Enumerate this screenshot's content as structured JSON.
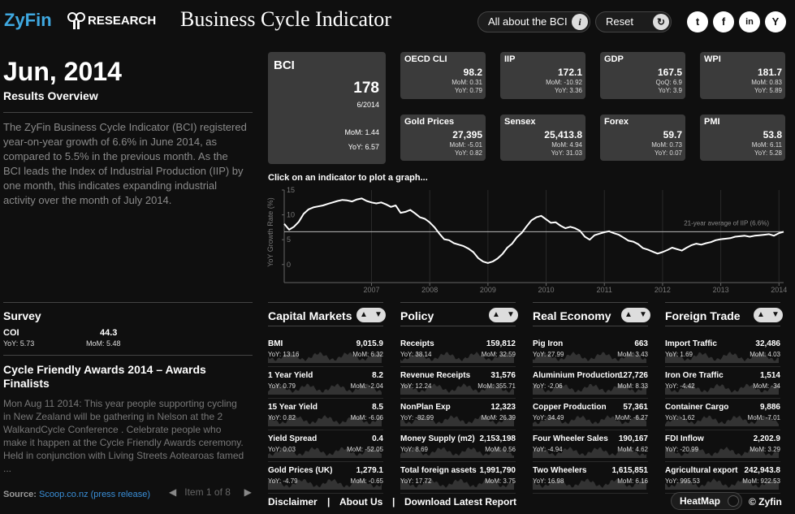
{
  "header": {
    "logo_zy": "ZyFin",
    "logo_research": "RESEARCH",
    "title": "Business Cycle Indicator",
    "about_label": "All about the BCI",
    "reset_label": "Reset",
    "social": [
      "t",
      "f",
      "in",
      "Y"
    ]
  },
  "overview": {
    "date": "Jun, 2014",
    "subtitle": "Results Overview",
    "summary": "The ZyFin Business Cycle Indicator (BCI) registered year-on-year growth of 6.6% in June 2014, as compared to 5.5% in the previous month. As the BCI leads the Index of Industrial Production (IIP) by one month, this indicates expanding industrial activity over the month of July 2014."
  },
  "survey": {
    "title": "Survey",
    "name": "COI",
    "value": "44.3",
    "yoy": "YoY: 5.73",
    "mom": "MoM: 5.48"
  },
  "news": {
    "title": "Cycle Friendly Awards 2014 – Awards Finalists",
    "body": "Mon Aug 11 2014: This year people supporting cycling in New Zealand will be gathering in Nelson at the 2 WalkandCycle Conference . Celebrate people who make it happen at the Cycle Friendly Awards ceremony. Held in conjunction with Living Streets Aotearoas famed ...",
    "source_label": "Source:",
    "source_link": "Scoop.co.nz (press release)",
    "pager": "Item 1 of 8"
  },
  "bci": {
    "name": "BCI",
    "value": "178",
    "period": "6/2014",
    "mom": "MoM: 1.44",
    "yoy": "YoY: 6.57"
  },
  "tiles": [
    {
      "name": "OECD CLI",
      "value": "98.2",
      "s1": "MoM: 0.31",
      "s2": "YoY: 0.79"
    },
    {
      "name": "IIP",
      "value": "172.1",
      "s1": "MoM: -10.92",
      "s2": "YoY: 3.36"
    },
    {
      "name": "GDP",
      "value": "167.5",
      "s1": "QoQ: 6.9",
      "s2": "YoY: 3.9"
    },
    {
      "name": "WPI",
      "value": "181.7",
      "s1": "MoM: 0.83",
      "s2": "YoY: 5.89"
    },
    {
      "name": "Gold Prices",
      "value": "27,395",
      "s1": "MoM: -5.01",
      "s2": "YoY: 0.82"
    },
    {
      "name": "Sensex",
      "value": "25,413.8",
      "s1": "MoM: 4.94",
      "s2": "YoY: 31.03"
    },
    {
      "name": "Forex",
      "value": "59.7",
      "s1": "MoM: 0.73",
      "s2": "YoY: 0.07"
    },
    {
      "name": "PMI",
      "value": "53.8",
      "s1": "MoM: 6.11",
      "s2": "YoY: 5.28"
    }
  ],
  "chart_hint": "Click on an indicator to plot a graph...",
  "chart_data": {
    "type": "line",
    "ylabel": "YoY Growth Rate (%)",
    "yticks": [
      "15",
      "10",
      "5",
      "0"
    ],
    "xticks": [
      "2007",
      "2008",
      "2009",
      "2010",
      "2011",
      "2012",
      "2013",
      "2014"
    ],
    "ylim": [
      -2,
      15
    ],
    "annotation": "21-year average of IIP (6.6%)",
    "average": 6.6,
    "series": [
      {
        "x_start": 2006.0,
        "x_step": 0.0833,
        "values": [
          8.2,
          7.0,
          7.6,
          8.6,
          10.2,
          11.1,
          11.5,
          11.7,
          11.9,
          12.2,
          12.5,
          12.8,
          13.0,
          12.9,
          12.7,
          13.1,
          13.3,
          12.8,
          12.5,
          12.3,
          12.5,
          12.1,
          11.6,
          11.9,
          10.4,
          10.6,
          11.0,
          10.3,
          9.5,
          9.2,
          8.5,
          7.5,
          6.2,
          5.1,
          4.9,
          4.3,
          4.0,
          3.7,
          3.2,
          2.5,
          1.3,
          0.6,
          0.3,
          0.6,
          1.2,
          2.1,
          3.4,
          4.2,
          5.5,
          6.4,
          7.7,
          8.9,
          9.5,
          9.8,
          9.1,
          8.4,
          8.5,
          7.8,
          7.3,
          7.6,
          7.3,
          6.8,
          5.6,
          5.0,
          5.9,
          6.2,
          6.5,
          6.7,
          6.3,
          6.0,
          5.4,
          4.8,
          4.6,
          4.1,
          3.3,
          3.0,
          2.6,
          2.2,
          2.5,
          2.9,
          3.4,
          3.1,
          2.8,
          3.4,
          3.9,
          4.2,
          4.0,
          4.3,
          4.5,
          4.9,
          5.1,
          5.2,
          5.3,
          5.6,
          5.7,
          5.8,
          5.6,
          5.8,
          5.9,
          6.0,
          6.1,
          5.8,
          6.3,
          6.6
        ]
      }
    ]
  },
  "panels": [
    {
      "title": "Capital Markets",
      "rows": [
        {
          "name": "BMI",
          "value": "9,015.9",
          "yoy": "YoY: 13.16",
          "mom": "MoM: 6.32"
        },
        {
          "name": "1 Year Yield",
          "value": "8.2",
          "yoy": "YoY: 0.79",
          "mom": "MoM: -2.04"
        },
        {
          "name": "15 Year Yield",
          "value": "8.5",
          "yoy": "YoY: 0.82",
          "mom": "MoM: -6.06"
        },
        {
          "name": "Yield Spread",
          "value": "0.4",
          "yoy": "YoY: 0.03",
          "mom": "MoM: -52.05"
        },
        {
          "name": "Gold Prices (UK)",
          "value": "1,279.1",
          "yoy": "YoY: -4.79",
          "mom": "MoM: -0.65"
        }
      ]
    },
    {
      "title": "Policy",
      "rows": [
        {
          "name": "Receipts",
          "value": "159,812",
          "yoy": "YoY: 38.14",
          "mom": "MoM: 32.59"
        },
        {
          "name": "Revenue Receipts",
          "value": "31,576",
          "yoy": "YoY: 12.24",
          "mom": "MoM: 355.71"
        },
        {
          "name": "NonPlan Exp",
          "value": "12,323",
          "yoy": "YoY: -82.99",
          "mom": "MoM: 26.39"
        },
        {
          "name": "Money Supply (m2)",
          "value": "2,153,198",
          "yoy": "YoY: 8.69",
          "mom": "MoM: 0.56"
        },
        {
          "name": "Total foreign assets",
          "value": "1,991,790",
          "yoy": "YoY: 17.72",
          "mom": "MoM: 3.75"
        }
      ]
    },
    {
      "title": "Real Economy",
      "rows": [
        {
          "name": "Pig Iron",
          "value": "663",
          "yoy": "YoY: 27.99",
          "mom": "MoM: 3.43"
        },
        {
          "name": "Aluminium Production",
          "value": "127,726",
          "yoy": "YoY: -2.06",
          "mom": "MoM: 8.33"
        },
        {
          "name": "Copper Production",
          "value": "57,361",
          "yoy": "YoY: 34.49",
          "mom": "MoM: -6.27"
        },
        {
          "name": "Four Wheeler Sales",
          "value": "190,167",
          "yoy": "YoY: -4.94",
          "mom": "MoM: 4.62"
        },
        {
          "name": "Two Wheelers",
          "value": "1,615,851",
          "yoy": "YoY: 16.98",
          "mom": "MoM: 6.16"
        }
      ]
    },
    {
      "title": "Foreign Trade",
      "rows": [
        {
          "name": "Import Traffic",
          "value": "32,486",
          "yoy": "YoY: 1.69",
          "mom": "MoM: 4.03"
        },
        {
          "name": "Iron Ore Traffic",
          "value": "1,514",
          "yoy": "YoY: -4.42",
          "mom": "MoM: -34"
        },
        {
          "name": "Container Cargo",
          "value": "9,886",
          "yoy": "YoY: -1.62",
          "mom": "MoM: -7.01"
        },
        {
          "name": "FDI Inflow",
          "value": "2,202.9",
          "yoy": "YoY: -20.99",
          "mom": "MoM: 3.29"
        },
        {
          "name": "Agricultural export",
          "value": "242,943.8",
          "yoy": "YoY: 995.53",
          "mom": "MoM: 922.53"
        }
      ]
    }
  ],
  "footer": {
    "disclaimer": "Disclaimer",
    "sep": "|",
    "about": "About Us",
    "download": "Download Latest Report",
    "heatmap": "HeatMap",
    "copyright": "© Zyfin"
  }
}
